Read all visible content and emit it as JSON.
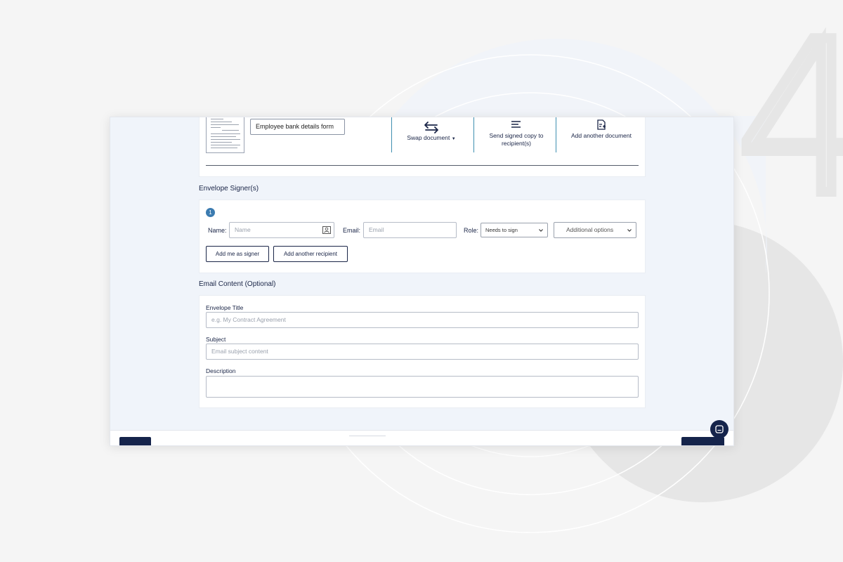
{
  "document": {
    "name": "Employee bank details form",
    "actions": [
      {
        "label": "Swap document",
        "icon": "swap-icon"
      },
      {
        "label": "Send signed copy to recipient(s)",
        "icon": "lines-icon"
      },
      {
        "label": "Add another document",
        "icon": "add-document-icon"
      }
    ]
  },
  "signers": {
    "section_title": "Envelope Signer(s)",
    "step_number": "1",
    "name_label": "Name:",
    "name_placeholder": "Name",
    "email_label": "Email:",
    "email_placeholder": "Email",
    "role_label": "Role:",
    "role_value": "Needs to sign",
    "options_value": "Additional options",
    "add_me_label": "Add me as signer",
    "add_recipient_label": "Add another recipient"
  },
  "email_content": {
    "section_title": "Email Content (Optional)",
    "envelope_title_label": "Envelope Title",
    "envelope_title_placeholder": "e.g. My Contract Agreement",
    "subject_label": "Subject",
    "subject_placeholder": "Email subject content",
    "description_label": "Description"
  },
  "background": {
    "step_digit": "4"
  },
  "colors": {
    "navy": "#15244b",
    "accent_blue": "#3b7bb0",
    "panel_bg": "#f0f4fa"
  }
}
